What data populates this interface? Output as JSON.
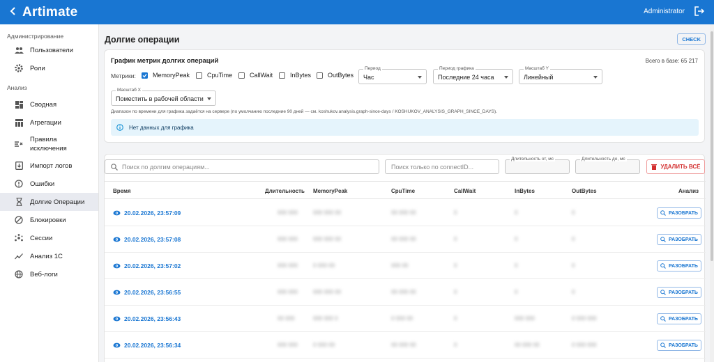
{
  "app": {
    "logo": "Artimate",
    "user": "Administrator"
  },
  "sidebar": {
    "sections": [
      {
        "title": "Администрирование",
        "items": [
          {
            "label": "Пользователи",
            "icon": "users-icon"
          },
          {
            "label": "Роли",
            "icon": "gear-icon"
          }
        ]
      },
      {
        "title": "Анализ",
        "items": [
          {
            "label": "Сводная",
            "icon": "dashboard-icon"
          },
          {
            "label": "Агрегации",
            "icon": "table-icon"
          },
          {
            "label": "Правила исключения",
            "icon": "rule-icon"
          },
          {
            "label": "Импорт логов",
            "icon": "import-icon"
          },
          {
            "label": "Ошибки",
            "icon": "error-icon"
          },
          {
            "label": "Долгие Операции",
            "icon": "hourglass-icon",
            "active": true
          },
          {
            "label": "Блокировки",
            "icon": "block-icon"
          },
          {
            "label": "Сессии",
            "icon": "sessions-icon"
          },
          {
            "label": "Анализ 1С",
            "icon": "analytics-icon"
          },
          {
            "label": "Веб-логи",
            "icon": "globe-icon"
          }
        ]
      }
    ]
  },
  "page": {
    "title": "Долгие операции",
    "check_label": "CHECK"
  },
  "chart_card": {
    "title": "График метрик долгих операций",
    "total": "Всего в базе: 65 217",
    "metrics_label": "Метрики:",
    "metrics": [
      {
        "label": "MemoryPeak",
        "checked": true
      },
      {
        "label": "CpuTime",
        "checked": false
      },
      {
        "label": "CallWait",
        "checked": false
      },
      {
        "label": "InBytes",
        "checked": false
      },
      {
        "label": "OutBytes",
        "checked": false
      }
    ],
    "period": {
      "caption": "Период",
      "value": "Час"
    },
    "graph_period": {
      "caption": "Период графика",
      "value": "Последние 24 часа"
    },
    "scale_y": {
      "caption": "Масштаб Y",
      "value": "Линейный"
    },
    "scale_x": {
      "caption": "Масштаб X",
      "value": "Поместить в рабочей области"
    },
    "hint": "Диапазон по времени для графика задаётся на сервере (по умолчанию последние 90 дней — см. koshukov.analysis.graph-since-days / KOSHUKOV_ANALYSIS_GRAPH_SINCE_DAYS).",
    "info": "Нет данных для графика"
  },
  "filters": {
    "search_placeholder": "Поиск по долгим операциям...",
    "connect_placeholder": "Поиск только по connectID...",
    "duration_from": "Длительность от, мс",
    "duration_to": "Длительность до, мс",
    "delete_all": "УДАЛИТЬ ВСЁ"
  },
  "table": {
    "headers": [
      "Время",
      "Длительность",
      "MemoryPeak",
      "CpuTime",
      "CallWait",
      "InBytes",
      "OutBytes",
      "Анализ"
    ],
    "analyze_label": "РАЗОБРАТЬ",
    "rows": [
      {
        "time": "20.02.2026, 23:57:09",
        "duration": "000 000",
        "memory": "000 000 00",
        "cpu": "00 000 00",
        "callwait": "0",
        "inbytes": "0",
        "outbytes": "0"
      },
      {
        "time": "20.02.2026, 23:57:08",
        "duration": "000 000",
        "memory": "000 000 00",
        "cpu": "00 000 00",
        "callwait": "0",
        "inbytes": "0",
        "outbytes": "0"
      },
      {
        "time": "20.02.2026, 23:57:02",
        "duration": "000 000",
        "memory": "0 000 00",
        "cpu": "000 00",
        "callwait": "0",
        "inbytes": "0",
        "outbytes": "0"
      },
      {
        "time": "20.02.2026, 23:56:55",
        "duration": "000 000",
        "memory": "000 000 00",
        "cpu": "00 000 00",
        "callwait": "0",
        "inbytes": "0",
        "outbytes": "0"
      },
      {
        "time": "20.02.2026, 23:56:43",
        "duration": "00 000",
        "memory": "000 000 0",
        "cpu": "0 000 00",
        "callwait": "0",
        "inbytes": "000 000",
        "outbytes": "0 000 000"
      },
      {
        "time": "20.02.2026, 23:56:34",
        "duration": "000 000",
        "memory": "0 000 00",
        "cpu": "00 000 00",
        "callwait": "0",
        "inbytes": "00 000 00",
        "outbytes": "0 000 000"
      }
    ]
  },
  "colors": {
    "primary": "#1976d2",
    "danger": "#d32f2f",
    "info_bg": "#e5f4fc"
  }
}
